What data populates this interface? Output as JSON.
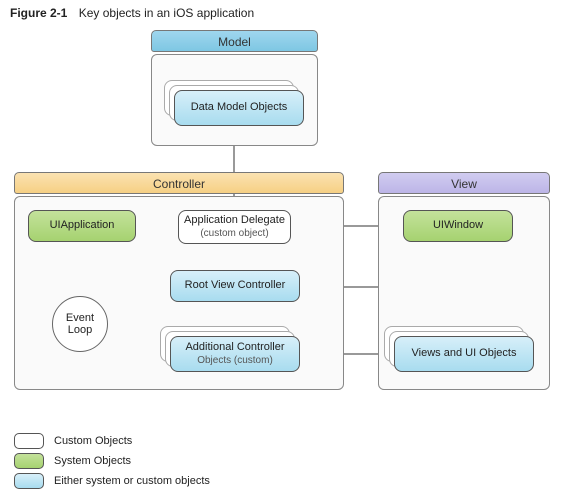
{
  "caption": {
    "fignum": "Figure 2-1",
    "title": "Key objects in an iOS application"
  },
  "panels": {
    "model": {
      "label": "Model"
    },
    "controller": {
      "label": "Controller"
    },
    "view": {
      "label": "View"
    }
  },
  "nodes": {
    "data_model": {
      "label": "Data Model Objects"
    },
    "uiapplication": {
      "label": "UIApplication"
    },
    "app_delegate": {
      "label": "Application Delegate",
      "sub": "(custom object)"
    },
    "root_vc": {
      "label": "Root View Controller"
    },
    "addl_controllers": {
      "label": "Additional Controller",
      "sub": "Objects (custom)"
    },
    "uiwindow": {
      "label": "UIWindow"
    },
    "views_ui": {
      "label": "Views and UI Objects"
    },
    "event_loop": {
      "label": "Event\nLoop"
    }
  },
  "legend": {
    "custom": "Custom Objects",
    "system": "System Objects",
    "either": "Either system or custom objects"
  },
  "chart_data": {
    "type": "diagram",
    "title": "Key objects in an iOS application",
    "groups": [
      {
        "id": "model",
        "label": "Model",
        "color_role": "either"
      },
      {
        "id": "controller",
        "label": "Controller",
        "color_role": "either"
      },
      {
        "id": "view",
        "label": "View",
        "color_role": "either"
      }
    ],
    "nodes": [
      {
        "id": "data_model",
        "label": "Data Model Objects",
        "group": "model",
        "category": "either",
        "stacked": true
      },
      {
        "id": "uiapplication",
        "label": "UIApplication",
        "group": "controller",
        "category": "system"
      },
      {
        "id": "app_delegate",
        "label": "Application Delegate (custom object)",
        "group": "controller",
        "category": "custom"
      },
      {
        "id": "root_vc",
        "label": "Root View Controller",
        "group": "controller",
        "category": "either"
      },
      {
        "id": "addl_controllers",
        "label": "Additional Controller Objects (custom)",
        "group": "controller",
        "category": "either",
        "stacked": true
      },
      {
        "id": "event_loop",
        "label": "Event Loop",
        "group": "controller",
        "category": "system",
        "shape": "ring"
      },
      {
        "id": "uiwindow",
        "label": "UIWindow",
        "group": "view",
        "category": "system"
      },
      {
        "id": "views_ui",
        "label": "Views and UI Objects",
        "group": "view",
        "category": "either",
        "stacked": true
      }
    ],
    "edges": [
      {
        "from": "data_model",
        "to": "app_delegate",
        "bidirectional": true
      },
      {
        "from": "uiapplication",
        "to": "app_delegate",
        "bidirectional": false
      },
      {
        "from": "uiapplication",
        "to": "event_loop",
        "bidirectional": false
      },
      {
        "from": "app_delegate",
        "to": "root_vc",
        "bidirectional": false
      },
      {
        "from": "root_vc",
        "to": "addl_controllers",
        "bidirectional": false
      },
      {
        "from": "app_delegate",
        "to": "uiwindow",
        "bidirectional": false
      },
      {
        "from": "uiwindow",
        "to": "root_vc",
        "bidirectional": false
      },
      {
        "from": "uiwindow",
        "to": "views_ui",
        "bidirectional": true
      },
      {
        "from": "addl_controllers",
        "to": "views_ui",
        "bidirectional": true
      }
    ],
    "legend": [
      {
        "category": "custom",
        "label": "Custom Objects",
        "fill": "white"
      },
      {
        "category": "system",
        "label": "System Objects",
        "fill": "green"
      },
      {
        "category": "either",
        "label": "Either system or custom objects",
        "fill": "blue"
      }
    ]
  }
}
